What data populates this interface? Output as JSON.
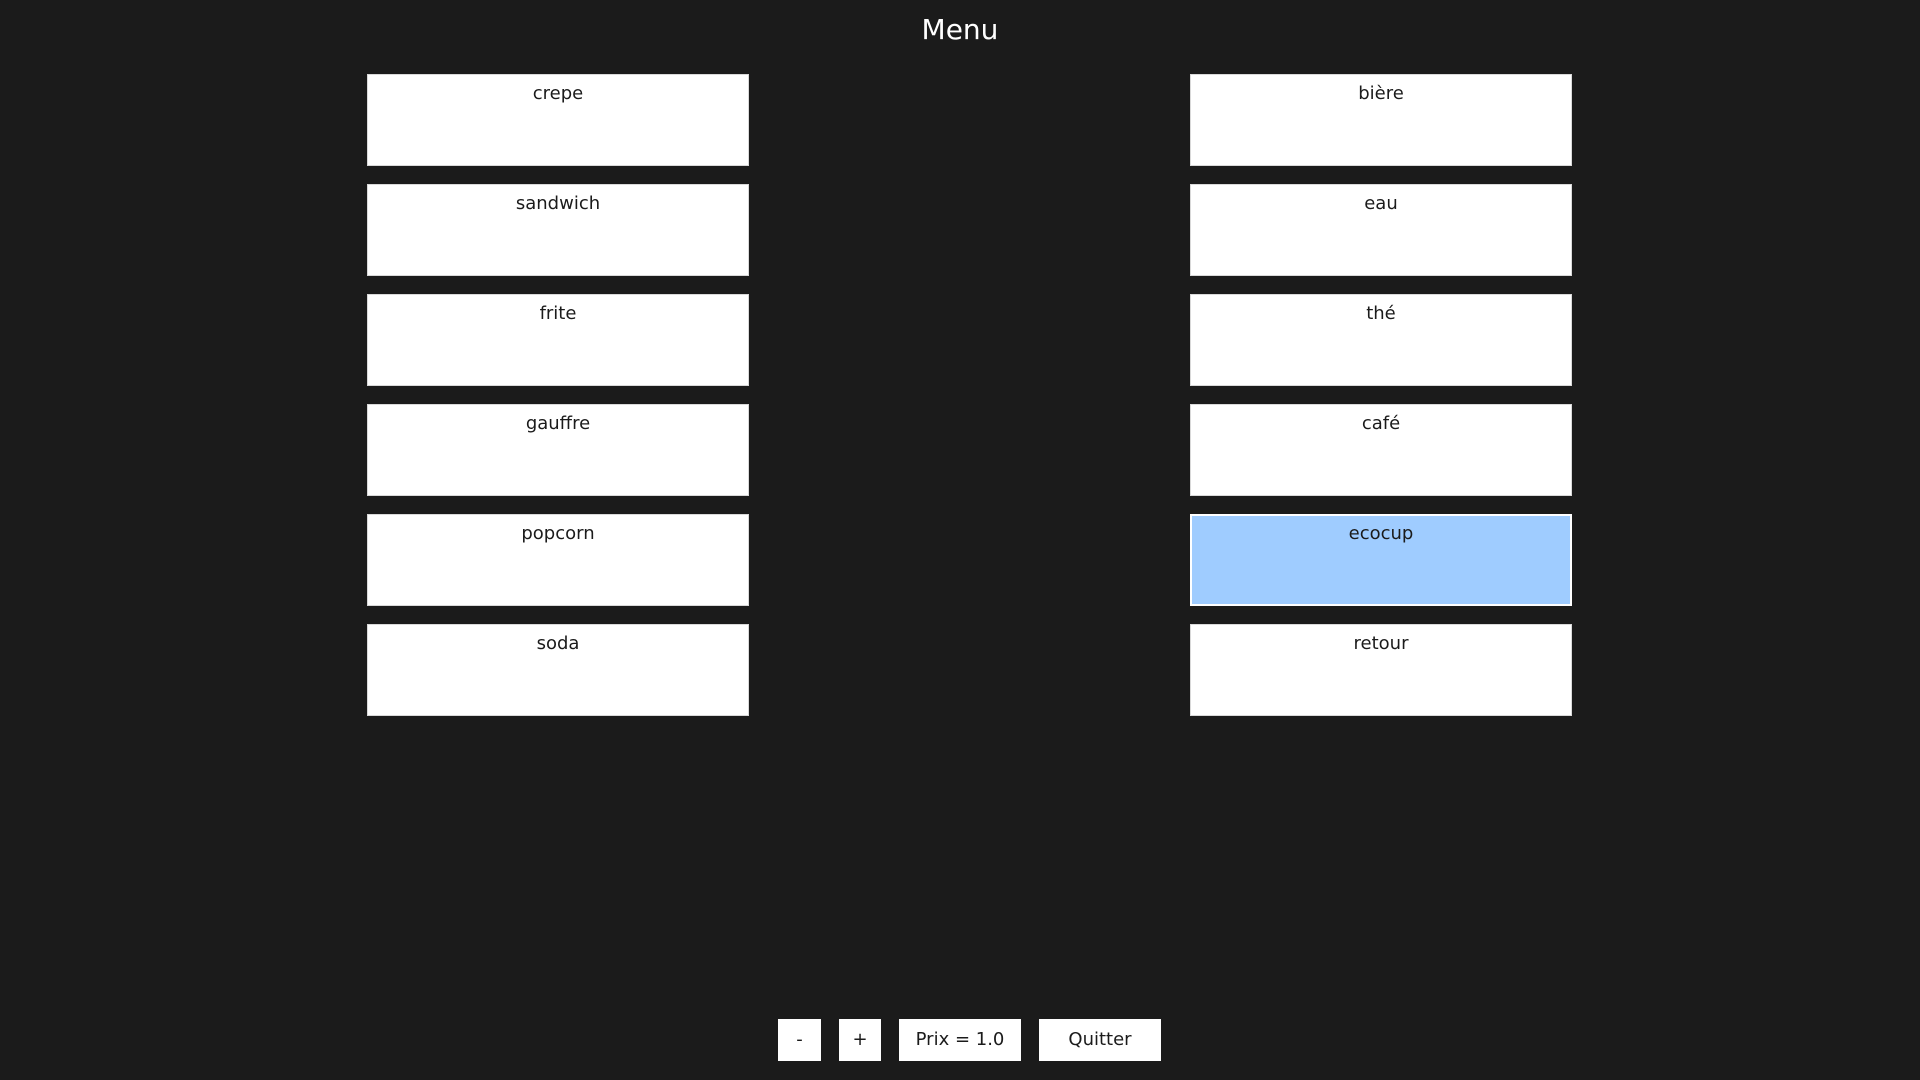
{
  "header": {
    "title": "Menu"
  },
  "food_items": [
    {
      "label": "crepe"
    },
    {
      "label": "sandwich"
    },
    {
      "label": "frite"
    },
    {
      "label": "gauffre"
    },
    {
      "label": "popcorn"
    },
    {
      "label": "soda"
    }
  ],
  "drink_items": [
    {
      "label": "bière"
    },
    {
      "label": "eau"
    },
    {
      "label": "thé"
    },
    {
      "label": "café"
    },
    {
      "label": "ecocup",
      "selected": true
    },
    {
      "label": "retour"
    }
  ],
  "controls": {
    "minus_label": "-",
    "plus_label": "+",
    "price_text": "Prix = 1.0",
    "quit_label": "Quitter"
  },
  "colors": {
    "background": "#1b1b1b",
    "button": "#ffffff",
    "selected": "#9fccff"
  }
}
